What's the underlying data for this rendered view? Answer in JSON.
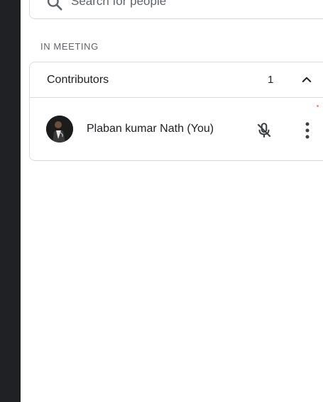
{
  "search": {
    "placeholder": "Search for people"
  },
  "section": {
    "heading": "IN MEETING"
  },
  "group": {
    "title": "Contributors",
    "count": "1"
  },
  "participants": [
    {
      "name": "Plaban kumar Nath (You)",
      "mic_state": "muted"
    }
  ],
  "colors": {
    "sidebar_dark": "#202124",
    "border": "#dadce0",
    "text_primary": "#202124",
    "text_secondary": "#5f6368"
  },
  "icons": {
    "search": "search-icon",
    "collapse": "chevron-up-icon",
    "mic": "mic-off-icon",
    "more": "more-vert-icon"
  }
}
